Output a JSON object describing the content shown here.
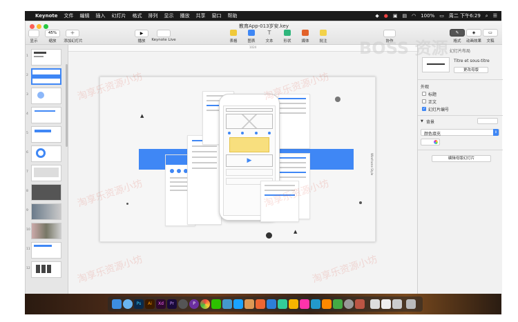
{
  "menubar": {
    "apple": "",
    "items": [
      "Keynote",
      "文件",
      "编辑",
      "插入",
      "幻灯片",
      "格式",
      "排列",
      "显示",
      "播放",
      "共享",
      "窗口",
      "帮助"
    ],
    "battery": "100%",
    "clock": "周二 下午6:29"
  },
  "window": {
    "title": "教育App-013岁安.key",
    "toolbar": {
      "display": "显示",
      "zoom": "45%",
      "zoom_label": "缩放",
      "add_slide": "添加幻灯片",
      "play": "播放",
      "keynote_live": "Keynote Live",
      "table": "表格",
      "chart": "图表",
      "text": "文本",
      "shape": "形状",
      "media": "媒体",
      "comment": "批注",
      "collaborate": "协作",
      "format": "格式",
      "animate": "动画效果",
      "document": "文稿"
    }
  },
  "navigator": {
    "slides": [
      "1",
      "2",
      "3",
      "4",
      "5",
      "6",
      "7",
      "8",
      "9",
      "10",
      "11",
      "12"
    ]
  },
  "ruler": {
    "mark": "1024"
  },
  "slide_content": {
    "rotated_label": "Wireframe Style",
    "page_dot": "●"
  },
  "inspector": {
    "header": "幻灯片布局",
    "layout_name": "Titre et sous-titre",
    "change_master": "更改母版",
    "appearance": "外观",
    "opt_title": "标题",
    "opt_body": "正文",
    "opt_slide_number": "幻灯片编号",
    "background": "背景",
    "fill_type": "颜色填充",
    "edit_master": "编辑母版幻灯片"
  },
  "watermarks": [
    "BOSS 资源",
    "淘享乐资源小坊"
  ],
  "colors": {
    "accent_blue": "#3f87f5",
    "menubar": "#1b1b1b",
    "keynote_yellow": "#f0c93a"
  }
}
